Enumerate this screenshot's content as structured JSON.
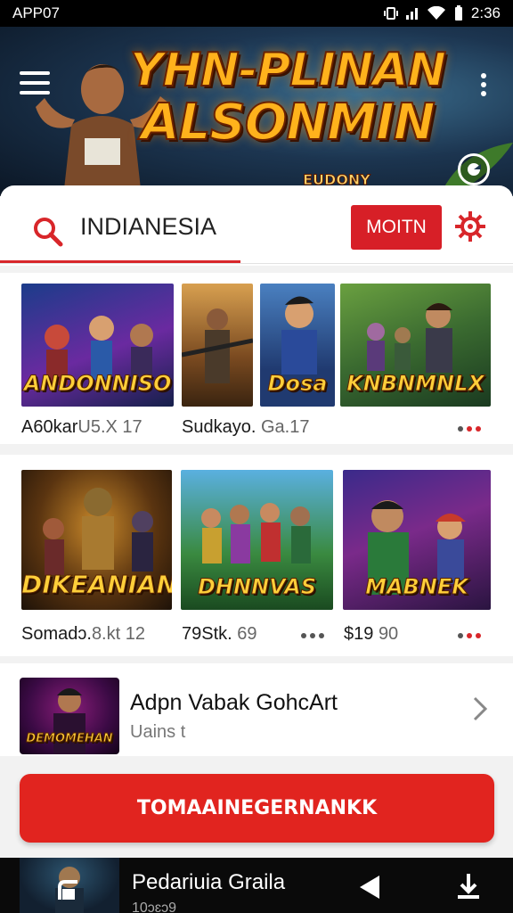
{
  "status_bar": {
    "app_label": "APP07",
    "time": "2:36"
  },
  "hero": {
    "title_line1": "YHN-PLINAN",
    "title_line2": "ALSONMIN",
    "subtitle": "EUDONY"
  },
  "search": {
    "value": "INDIANESIA",
    "button_label": "MOITN"
  },
  "row1": [
    {
      "title": "ANDONNISO",
      "label": "A60kar",
      "sub": "U5.X 17"
    },
    {
      "title": "",
      "label": "Sudkayo.",
      "sub": "Ga.17"
    },
    {
      "title": "Dosa",
      "label": "",
      "sub": ""
    },
    {
      "title": "KNBNMNLX",
      "label": "",
      "sub": ""
    }
  ],
  "row2": [
    {
      "title": "DIKEANIAN",
      "label": "Somadɔ.",
      "sub": "8.kt 12"
    },
    {
      "title": "DHNNVAS",
      "label": "79Stk.",
      "sub": "69"
    },
    {
      "title": "MABNEK",
      "label": "$19",
      "sub": "90"
    }
  ],
  "featured": {
    "title": "Adpn Vabak GohcArt",
    "subtitle": "Uains t",
    "thumb_text": "DEMOMEHAN"
  },
  "cta_label": "TOMAAINEGERNANKK",
  "bottom_bar": {
    "title": "Pedariuia Graila",
    "subtitle": "10ɔɛɔ9"
  },
  "colors": {
    "accent": "#d71f27",
    "background": "#f2f2f2",
    "status_bar": "#000000"
  },
  "icons": [
    "menu-icon",
    "more-icon",
    "chat-icon",
    "search-icon",
    "settings-icon",
    "chevron-right-icon",
    "back-icon",
    "download-icon",
    "share-icon"
  ]
}
